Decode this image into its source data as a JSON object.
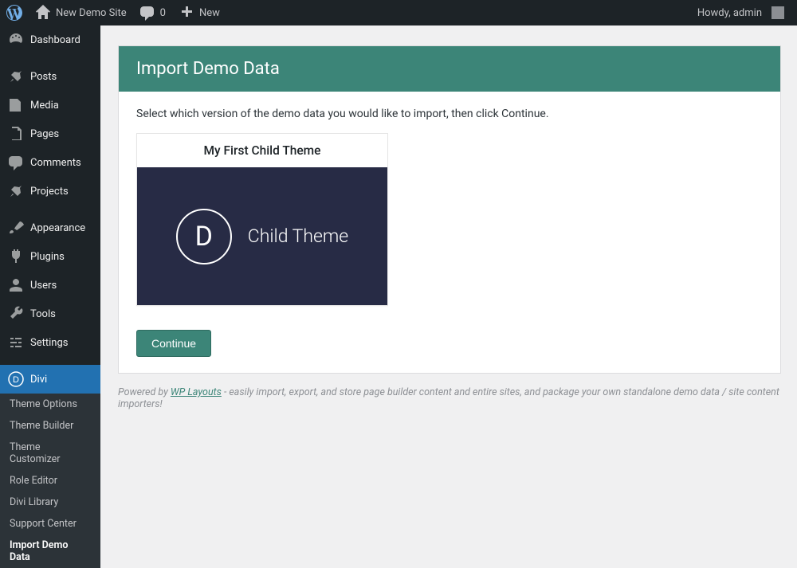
{
  "adminbar": {
    "site_name": "New Demo Site",
    "comments_count": "0",
    "new_label": "New",
    "howdy": "Howdy, admin"
  },
  "sidebar": {
    "dashboard": "Dashboard",
    "posts": "Posts",
    "media": "Media",
    "pages": "Pages",
    "comments": "Comments",
    "projects": "Projects",
    "appearance": "Appearance",
    "plugins": "Plugins",
    "users": "Users",
    "tools": "Tools",
    "settings": "Settings",
    "divi": "Divi",
    "submenu": {
      "theme_options": "Theme Options",
      "theme_builder": "Theme Builder",
      "theme_customizer": "Theme Customizer",
      "role_editor": "Role Editor",
      "divi_library": "Divi Library",
      "support_center": "Support Center",
      "import_demo": "Import Demo Data"
    }
  },
  "page": {
    "header": "Import Demo Data",
    "instruction": "Select which version of the demo data you would like to import, then click Continue.",
    "card_title": "My First Child Theme",
    "card_badge": "D",
    "card_label": "Child Theme",
    "continue": "Continue",
    "footer_prefix": "Powered by ",
    "footer_link": "WP Layouts",
    "footer_suffix": " - easily import, export, and store page builder content and entire sites, and package your own standalone demo data / site content importers!"
  }
}
